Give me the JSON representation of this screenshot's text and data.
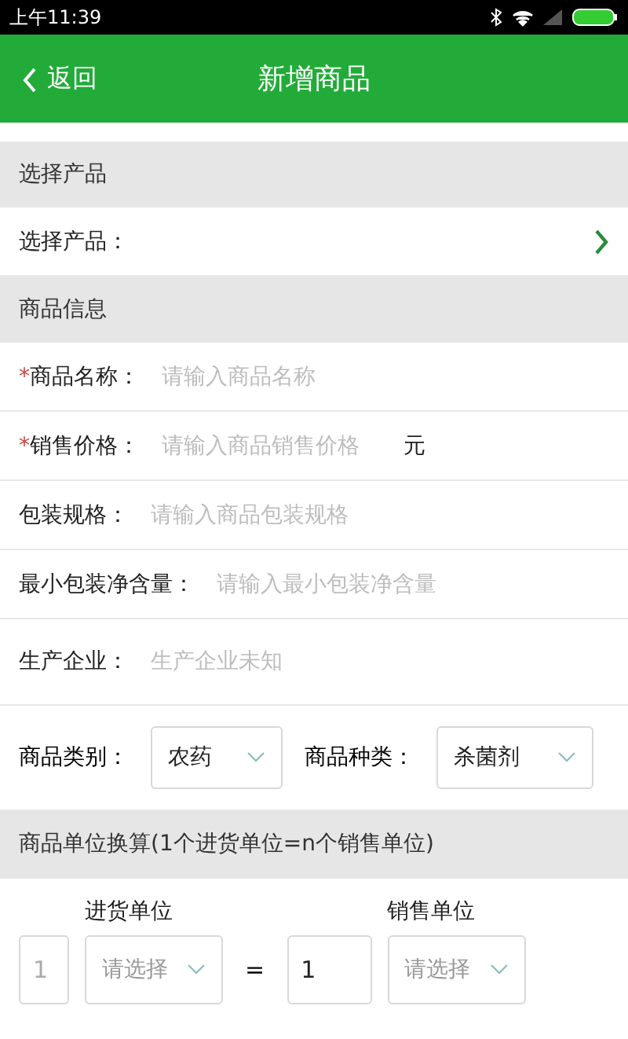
{
  "status_bar": {
    "time": "上午11:39"
  },
  "header": {
    "back": "返回",
    "title": "新增商品"
  },
  "product_section": {
    "title": "选择产品",
    "picker_label": "选择产品："
  },
  "info_section": {
    "title": "商品信息",
    "required_mark": "*",
    "fields": [
      {
        "label": "商品名称：",
        "required": true,
        "placeholder": "请输入商品名称"
      },
      {
        "label": "销售价格：",
        "required": true,
        "placeholder": "请输入商品销售价格",
        "unit": "元"
      },
      {
        "label": "包装规格：",
        "required": false,
        "placeholder": "请输入商品包装规格"
      },
      {
        "label": "最小包装净含量：",
        "required": false,
        "placeholder": "请输入最小包装净含量"
      },
      {
        "label": "生产企业：",
        "required": false,
        "placeholder": "生产企业未知"
      }
    ],
    "selects": [
      {
        "label": "商品类别：",
        "value": "农药"
      },
      {
        "label": "商品种类：",
        "value": "杀菌剂"
      }
    ]
  },
  "unit_section": {
    "title": "商品单位换算(1个进货单位=n个销售单位)",
    "purchase": {
      "heading": "进货单位",
      "quantity": "1",
      "quantity_disabled": true,
      "placeholder": "请选择"
    },
    "equals": "=",
    "sale": {
      "heading": "销售单位",
      "quantity": "1",
      "quantity_disabled": false,
      "placeholder": "请选择"
    }
  }
}
